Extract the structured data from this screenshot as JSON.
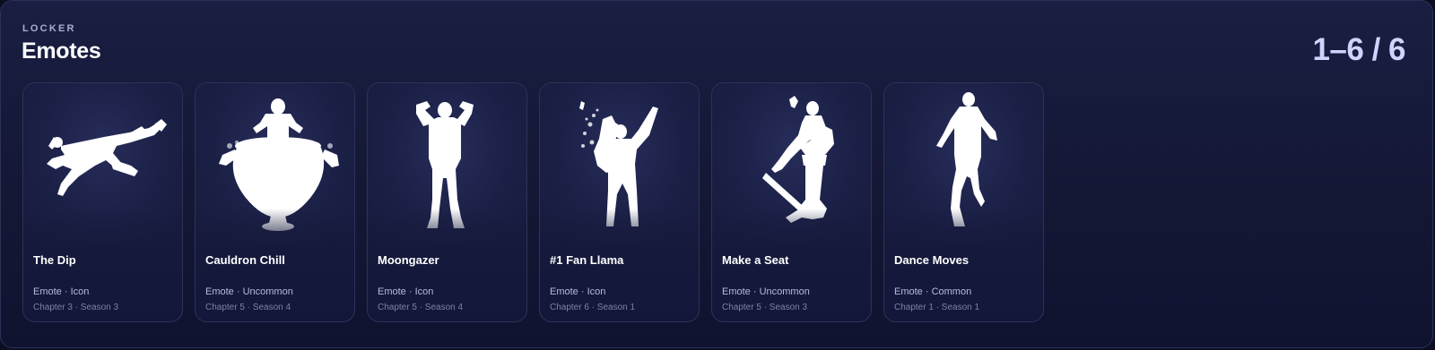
{
  "header": {
    "eyebrow": "LOCKER",
    "title": "Emotes",
    "counter": "1–6 / 6"
  },
  "cards": [
    {
      "name": "The Dip",
      "type": "Emote",
      "rarity": "Icon",
      "meta": "Emote · Icon",
      "season": "Chapter 3 · Season 3",
      "icon": "the-dip-silhouette-icon"
    },
    {
      "name": "Cauldron Chill",
      "type": "Emote",
      "rarity": "Uncommon",
      "meta": "Emote · Uncommon",
      "season": "Chapter 5 · Season 4",
      "icon": "cauldron-chill-silhouette-icon"
    },
    {
      "name": "Moongazer",
      "type": "Emote",
      "rarity": "Icon",
      "meta": "Emote · Icon",
      "season": "Chapter 5 · Season 4",
      "icon": "moongazer-silhouette-icon"
    },
    {
      "name": "#1 Fan Llama",
      "type": "Emote",
      "rarity": "Icon",
      "meta": "Emote · Icon",
      "season": "Chapter 6 · Season 1",
      "icon": "fan-llama-silhouette-icon"
    },
    {
      "name": "Make a Seat",
      "type": "Emote",
      "rarity": "Uncommon",
      "meta": "Emote · Uncommon",
      "season": "Chapter 5 · Season 3",
      "icon": "make-a-seat-silhouette-icon"
    },
    {
      "name": "Dance Moves",
      "type": "Emote",
      "rarity": "Common",
      "meta": "Emote · Common",
      "season": "Chapter 1 · Season 1",
      "icon": "dance-moves-silhouette-icon"
    }
  ],
  "colors": {
    "background": "#141835",
    "card": "#1a1f45",
    "border": "#2d3359",
    "counter": "#cfd4ff",
    "meta": "#b7bcda",
    "season": "#7d83a8"
  }
}
